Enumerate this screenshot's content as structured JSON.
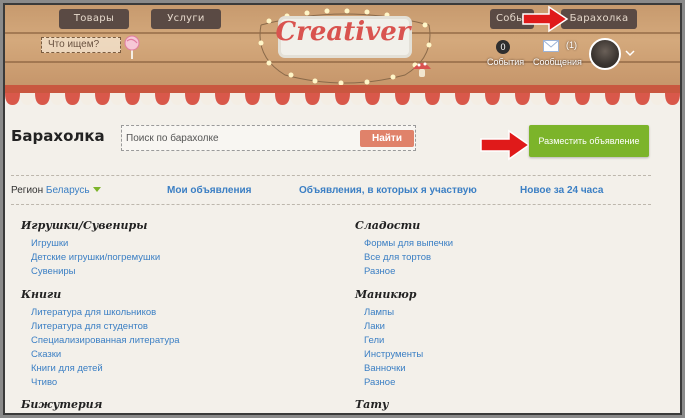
{
  "header": {
    "nav_tabs": [
      "Товары",
      "Услуги",
      "События",
      "Барахолка"
    ],
    "search_placeholder": "Что ищем?",
    "logo_text": "Creativer",
    "events": {
      "count": "0",
      "label": "События"
    },
    "messages": {
      "count": "(1)",
      "label": "Сообщения"
    }
  },
  "main": {
    "title": "Барахолка",
    "search": {
      "placeholder": "Поиск по барахолке",
      "button": "Найти"
    },
    "post_button": "Разместить объявление",
    "region": {
      "label": "Регион",
      "value": "Беларусь"
    },
    "sublinks": [
      "Мои объявления",
      "Объявления, в которых я участвую",
      "Новое за 24 часа"
    ]
  },
  "categories": {
    "left": [
      {
        "title": "Игрушки/Сувениры",
        "items": [
          "Игрушки",
          "Детские игрушки/погремушки",
          "Сувениры"
        ]
      },
      {
        "title": "Книги",
        "items": [
          "Литература для школьников",
          "Литература для студентов",
          "Специализированная литература",
          "Сказки",
          "Книги для детей",
          "Чтиво"
        ]
      },
      {
        "title": "Бижутерия",
        "items": []
      }
    ],
    "right": [
      {
        "title": "Сладости",
        "items": [
          "Формы для выпечки",
          "Все для тортов",
          "Разное"
        ]
      },
      {
        "title": "Маникюр",
        "items": [
          "Лампы",
          "Лаки",
          "Гели",
          "Инструменты",
          "Ванночки",
          "Разное"
        ]
      },
      {
        "title": "Тату",
        "items": []
      }
    ]
  },
  "colors": {
    "accent_green": "#7cb42a",
    "link_blue": "#3b7fc4",
    "search_button": "#e0826a",
    "arrow_red": "#e01a1a",
    "awning_red": "#d9584a"
  }
}
